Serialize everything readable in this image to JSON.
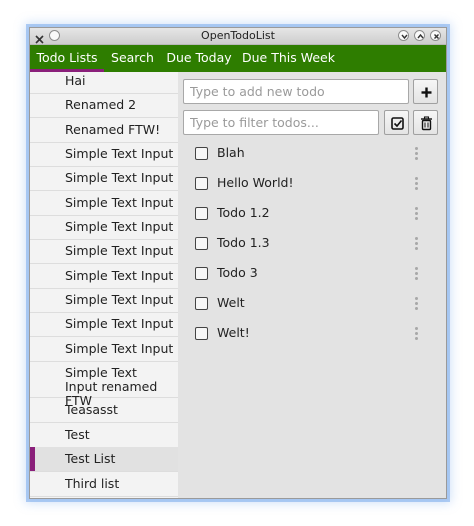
{
  "window": {
    "title": "OpenTodoList"
  },
  "tabs": [
    {
      "label": "Todo Lists",
      "active": true
    },
    {
      "label": "Search",
      "active": false
    },
    {
      "label": "Due Today",
      "active": false
    },
    {
      "label": "Due This Week",
      "active": false
    }
  ],
  "sidebar": {
    "items": [
      {
        "label": "Hai"
      },
      {
        "label": "Renamed 2"
      },
      {
        "label": "Renamed FTW!"
      },
      {
        "label": "Simple Text Input"
      },
      {
        "label": "Simple Text Input"
      },
      {
        "label": "Simple Text Input"
      },
      {
        "label": "Simple Text Input"
      },
      {
        "label": "Simple Text Input"
      },
      {
        "label": "Simple Text Input"
      },
      {
        "label": "Simple Text Input"
      },
      {
        "label": "Simple Text Input"
      },
      {
        "label": "Simple Text Input"
      },
      {
        "label": "Simple Text Input renamed FTW"
      },
      {
        "label": "Teasasst"
      },
      {
        "label": "Test"
      },
      {
        "label": "Test List",
        "selected": true
      },
      {
        "label": "Third list"
      }
    ]
  },
  "main": {
    "new_todo": {
      "value": "",
      "placeholder": "Type to add new todo"
    },
    "filter": {
      "value": "",
      "placeholder": "Type to filter todos..."
    },
    "add_button_icon": "plus-icon",
    "show_done_button_icon": "checkbox-checked-icon",
    "trash_button_icon": "trash-icon",
    "todos": [
      {
        "label": "Blah",
        "done": false
      },
      {
        "label": "Hello World!",
        "done": false
      },
      {
        "label": "Todo 1.2",
        "done": false
      },
      {
        "label": "Todo 1.3",
        "done": false
      },
      {
        "label": "Todo 3",
        "done": false
      },
      {
        "label": "Welt",
        "done": false
      },
      {
        "label": "Welt!",
        "done": false
      }
    ]
  },
  "colors": {
    "tabbar_bg": "#2e7d00",
    "accent": "#8a1f7a"
  }
}
